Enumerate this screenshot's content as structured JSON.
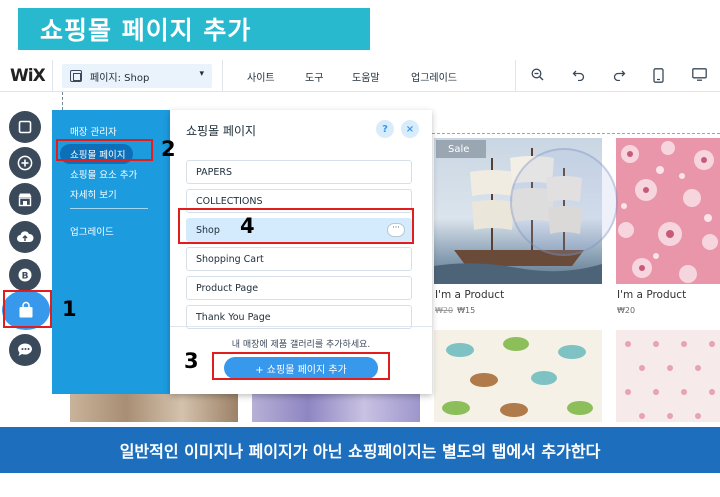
{
  "title": "쇼핑몰 페이지 추가",
  "topbar": {
    "logo": "WiX",
    "page_select": "페이지: Shop",
    "menu": [
      "사이트",
      "도구",
      "도움말",
      "업그레이드"
    ]
  },
  "side_menu": {
    "items": [
      "매장 관리자",
      "쇼핑몰 페이지",
      "쇼핑몰 요소 추가",
      "자세히 보기",
      "업그레이드"
    ]
  },
  "panel": {
    "title": "쇼핑몰 페이지",
    "help": "?",
    "close": "×",
    "pages": [
      "PAPERS",
      "COLLECTIONS",
      "Shop",
      "Shopping Cart",
      "Product Page",
      "Thank You Page"
    ],
    "more": "···",
    "footer_text": "내 매장에 제품 갤러리를 추가하세요.",
    "add_button": "+ 쇼핑몰 페이지 추가"
  },
  "steps": [
    "1",
    "2",
    "3",
    "4"
  ],
  "products": [
    {
      "name": "I'm a Product",
      "old_price": "₩20",
      "price": "₩15",
      "badge": "Sale"
    },
    {
      "name": "I'm a Product",
      "price": "₩20"
    }
  ],
  "caption": "일반적인 이미지나 페이지가 아닌 쇼핑페이지는 별도의 탭에서 추가한다",
  "colors": {
    "accent": "#3899ec",
    "sidebar": "#1c9bdf",
    "title_banner": "#28b9cf",
    "caption_bar": "#1d6fbd",
    "annotation": "#e01e1e",
    "tool_icon": "#3b4a5a"
  }
}
